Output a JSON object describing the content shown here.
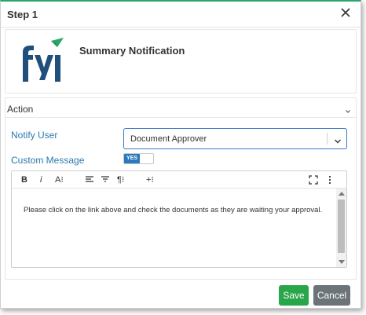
{
  "dialog": {
    "title": "Step 1",
    "close_icon": "close-icon"
  },
  "summary": {
    "logo_icon": "fyi-logo-icon",
    "title": "Summary Notification"
  },
  "action": {
    "header_label": "Action",
    "notify_user_label": "Notify User",
    "notify_user_value": "Document Approver",
    "custom_message_label": "Custom Message",
    "custom_message_toggle": "YES",
    "editor": {
      "toolbar": {
        "bold": "B",
        "italic": "i",
        "font_size": "A⁝"
      },
      "content": "Please click on the link above and check the documents as they are waiting your approval."
    }
  },
  "footer": {
    "save_label": "Save",
    "cancel_label": "Cancel"
  },
  "colors": {
    "accent_green": "#2aa66a",
    "save_green": "#2aa64a",
    "cancel_gray": "#6c7479",
    "label_blue": "#2a7ab0",
    "toggle_blue": "#2c79bd",
    "logo_blue": "#1f4f7a"
  }
}
